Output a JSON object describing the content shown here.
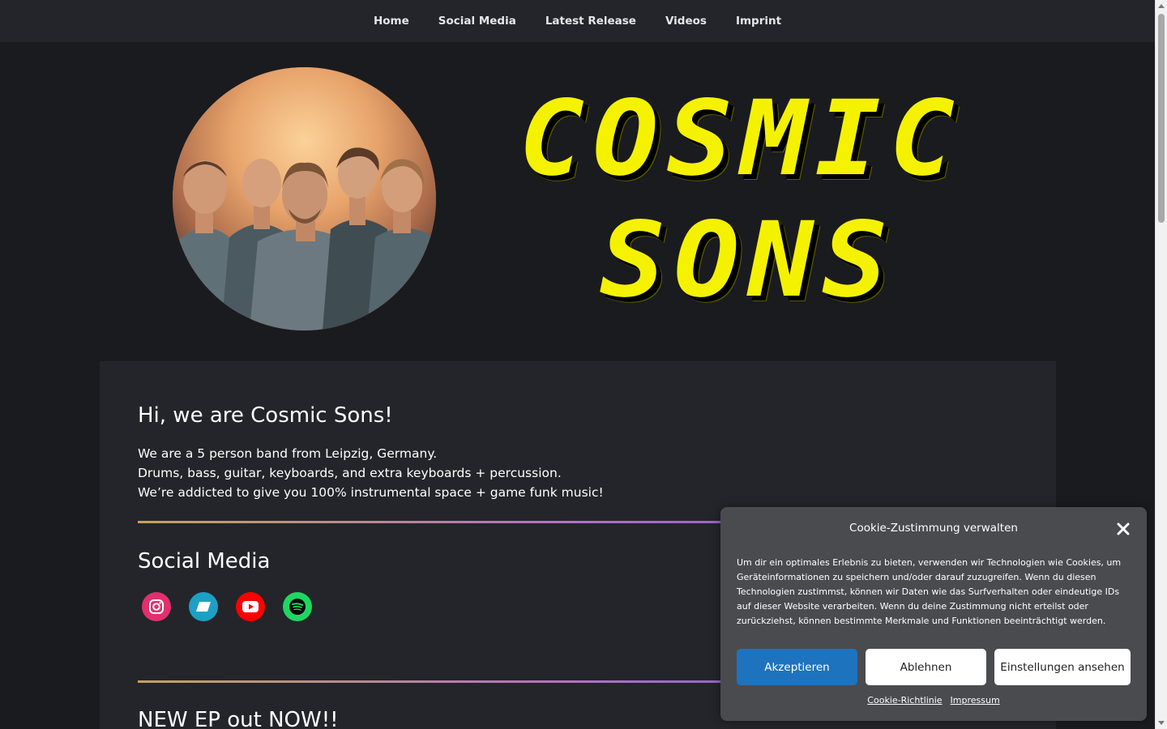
{
  "nav": {
    "items": [
      "Home",
      "Social Media",
      "Latest Release",
      "Videos",
      "Imprint"
    ]
  },
  "header": {
    "logo_line1": "COSMIC",
    "logo_line2": "SONS",
    "logo_color": "#f5f200"
  },
  "intro": {
    "heading": "Hi, we are Cosmic Sons!",
    "lines": [
      "We are a 5 person band from Leipzig, Germany.",
      "Drums, bass, guitar, keyboards, and extra keyboards + percussion.",
      "We’re addicted to give you 100% instrumental space + game funk music!"
    ]
  },
  "social": {
    "heading": "Social Media",
    "icons": [
      {
        "name": "instagram-icon",
        "color": "#e1306c"
      },
      {
        "name": "bandcamp-icon",
        "color": "#1da0c3"
      },
      {
        "name": "youtube-icon",
        "color": "#ff0000"
      },
      {
        "name": "spotify-icon",
        "color": "#1ed760"
      }
    ]
  },
  "release": {
    "heading": "NEW EP out NOW!!"
  },
  "cookie": {
    "title": "Cookie-Zustimmung verwalten",
    "body": "Um dir ein optimales Erlebnis zu bieten, verwenden wir Technologien wie Cookies, um Geräteinformationen zu speichern und/oder darauf zuzugreifen. Wenn du diesen Technologien zustimmst, können wir Daten wie das Surfverhalten oder eindeutige IDs auf dieser Website verarbeiten. Wenn du deine Zustimmung nicht erteilst oder zurückziehst, können bestimmte Merkmale und Funktionen beeinträchtigt werden.",
    "accept_label": "Akzeptieren",
    "deny_label": "Ablehnen",
    "settings_label": "Einstellungen ansehen",
    "policy_link": "Cookie-Richtlinie",
    "imprint_link": "Impressum"
  }
}
